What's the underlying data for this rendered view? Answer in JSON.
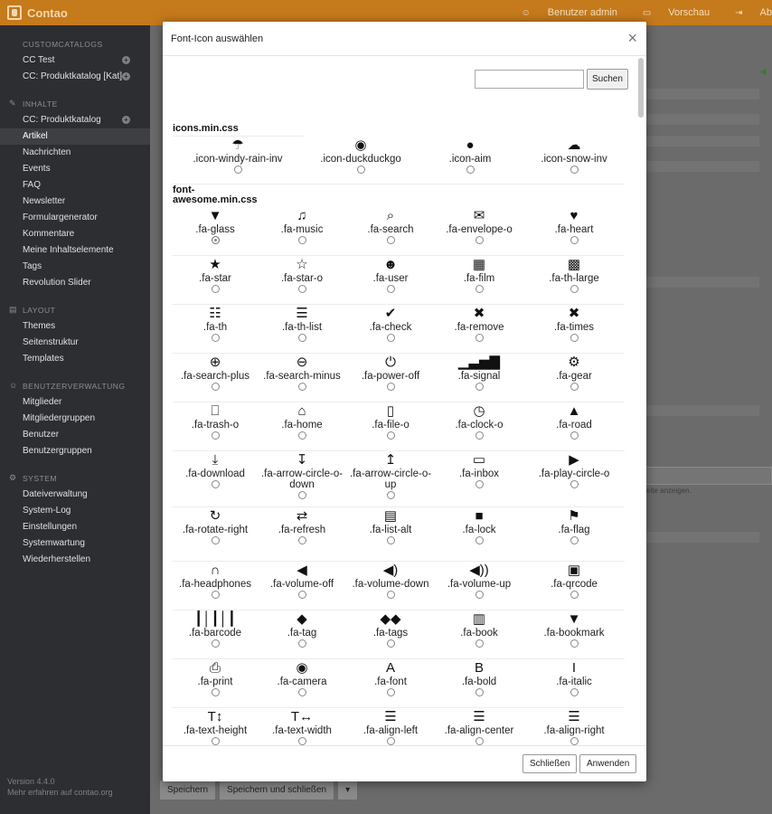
{
  "app": {
    "name": "Contao"
  },
  "header": {
    "nav": [
      {
        "icon": "user-icon",
        "glyph": "☺",
        "label": "Benutzer admin"
      },
      {
        "icon": "monitor-icon",
        "glyph": "▭",
        "label": "Vorschau"
      },
      {
        "icon": "logout-icon",
        "glyph": "⇥",
        "label": "Ab"
      }
    ]
  },
  "sidebar": {
    "groups": [
      {
        "title": "CUSTOMCATALOGS",
        "icon": "",
        "items": [
          {
            "label": "CC Test",
            "plus": true
          },
          {
            "label": "CC: Produktkatalog [Kat]",
            "plus": true
          }
        ]
      },
      {
        "title": "INHALTE",
        "icon": "✎",
        "items": [
          {
            "label": "CC: Produktkatalog",
            "plus": true
          },
          {
            "label": "Artikel",
            "active": true
          },
          {
            "label": "Nachrichten"
          },
          {
            "label": "Events"
          },
          {
            "label": "FAQ"
          },
          {
            "label": "Newsletter"
          },
          {
            "label": "Formulargenerator"
          },
          {
            "label": "Kommentare"
          },
          {
            "label": "Meine Inhaltselemente"
          },
          {
            "label": "Tags"
          },
          {
            "label": "Revolution Slider"
          }
        ]
      },
      {
        "title": "LAYOUT",
        "icon": "▤",
        "items": [
          {
            "label": "Themes"
          },
          {
            "label": "Seitenstruktur"
          },
          {
            "label": "Templates"
          }
        ]
      },
      {
        "title": "BENUTZERVERWALTUNG",
        "icon": "☺",
        "items": [
          {
            "label": "Mitglieder"
          },
          {
            "label": "Mitgliedergruppen"
          },
          {
            "label": "Benutzer"
          },
          {
            "label": "Benutzergruppen"
          }
        ]
      },
      {
        "title": "SYSTEM",
        "icon": "⚙",
        "items": [
          {
            "label": "Dateiverwaltung"
          },
          {
            "label": "System-Log"
          },
          {
            "label": "Einstellungen"
          },
          {
            "label": "Systemwartung"
          },
          {
            "label": "Wiederherstellen"
          }
        ]
      }
    ],
    "footer": {
      "version": "Version 4.4.0",
      "more": "Mehr erfahren auf contao.org"
    }
  },
  "main": {
    "save_label": "Speichern",
    "save_close_label": "Speichern und schließen",
    "hint": "seite anzeigen."
  },
  "modal": {
    "title": "Font-Icon auswählen",
    "close_glyph": "×",
    "search": {
      "placeholder": "",
      "button": "Suchen"
    },
    "sections": [
      {
        "title": "icons.min.css",
        "icons": [
          {
            "name": ".icon-windy-rain-inv",
            "glyph": "☂",
            "icon": "windy-rain-icon"
          },
          {
            "name": ".icon-duckduckgo",
            "glyph": "◉",
            "icon": "duckduckgo-icon"
          },
          {
            "name": ".icon-aim",
            "glyph": "●",
            "icon": "aim-icon"
          },
          {
            "name": ".icon-snow-inv",
            "glyph": "☁",
            "icon": "snow-icon"
          }
        ]
      },
      {
        "title": "font-awesome.min.css",
        "icons": [
          {
            "name": ".fa-glass",
            "glyph": "▼",
            "icon": "glass-icon",
            "checked": true
          },
          {
            "name": ".fa-music",
            "glyph": "♫",
            "icon": "music-icon"
          },
          {
            "name": ".fa-search",
            "glyph": "⌕",
            "icon": "search-icon"
          },
          {
            "name": ".fa-envelope-o",
            "glyph": "✉",
            "icon": "envelope-icon"
          },
          {
            "name": ".fa-heart",
            "glyph": "♥",
            "icon": "heart-icon"
          },
          {
            "name": ".fa-star",
            "glyph": "★",
            "icon": "star-icon"
          },
          {
            "name": ".fa-star-o",
            "glyph": "☆",
            "icon": "star-outline-icon"
          },
          {
            "name": ".fa-user",
            "glyph": "☻",
            "icon": "user-icon"
          },
          {
            "name": ".fa-film",
            "glyph": "▦",
            "icon": "film-icon"
          },
          {
            "name": ".fa-th-large",
            "glyph": "▩",
            "icon": "th-large-icon"
          },
          {
            "name": ".fa-th",
            "glyph": "☷",
            "icon": "th-icon"
          },
          {
            "name": ".fa-th-list",
            "glyph": "☰",
            "icon": "th-list-icon"
          },
          {
            "name": ".fa-check",
            "glyph": "✔",
            "icon": "check-icon"
          },
          {
            "name": ".fa-remove",
            "glyph": "✖",
            "icon": "remove-icon"
          },
          {
            "name": ".fa-times",
            "glyph": "✖",
            "icon": "times-icon"
          },
          {
            "name": ".fa-search-plus",
            "glyph": "⊕",
            "icon": "search-plus-icon"
          },
          {
            "name": ".fa-search-minus",
            "glyph": "⊖",
            "icon": "search-minus-icon"
          },
          {
            "name": ".fa-power-off",
            "glyph": "⏻",
            "icon": "power-off-icon"
          },
          {
            "name": ".fa-signal",
            "glyph": "▁▃▅▇",
            "icon": "signal-icon"
          },
          {
            "name": ".fa-gear",
            "glyph": "⚙",
            "icon": "gear-icon"
          },
          {
            "name": ".fa-trash-o",
            "glyph": "⎕",
            "icon": "trash-icon"
          },
          {
            "name": ".fa-home",
            "glyph": "⌂",
            "icon": "home-icon"
          },
          {
            "name": ".fa-file-o",
            "glyph": "▯",
            "icon": "file-icon"
          },
          {
            "name": ".fa-clock-o",
            "glyph": "◷",
            "icon": "clock-icon"
          },
          {
            "name": ".fa-road",
            "glyph": "▲",
            "icon": "road-icon"
          },
          {
            "name": ".fa-download",
            "glyph": "⤓",
            "icon": "download-icon"
          },
          {
            "name": ".fa-arrow-circle-o-down",
            "glyph": "↧",
            "icon": "arrow-circle-down-icon"
          },
          {
            "name": ".fa-arrow-circle-o-up",
            "glyph": "↥",
            "icon": "arrow-circle-up-icon"
          },
          {
            "name": ".fa-inbox",
            "glyph": "▭",
            "icon": "inbox-icon"
          },
          {
            "name": ".fa-play-circle-o",
            "glyph": "▶",
            "icon": "play-circle-icon"
          },
          {
            "name": ".fa-rotate-right",
            "glyph": "↻",
            "icon": "rotate-right-icon"
          },
          {
            "name": ".fa-refresh",
            "glyph": "⇄",
            "icon": "refresh-icon"
          },
          {
            "name": ".fa-list-alt",
            "glyph": "▤",
            "icon": "list-alt-icon"
          },
          {
            "name": ".fa-lock",
            "glyph": "■",
            "icon": "lock-icon"
          },
          {
            "name": ".fa-flag",
            "glyph": "⚑",
            "icon": "flag-icon"
          },
          {
            "name": ".fa-headphones",
            "glyph": "∩",
            "icon": "headphones-icon"
          },
          {
            "name": ".fa-volume-off",
            "glyph": "◀",
            "icon": "volume-off-icon"
          },
          {
            "name": ".fa-volume-down",
            "glyph": "◀)",
            "icon": "volume-down-icon"
          },
          {
            "name": ".fa-volume-up",
            "glyph": "◀))",
            "icon": "volume-up-icon"
          },
          {
            "name": ".fa-qrcode",
            "glyph": "▣",
            "icon": "qrcode-icon"
          },
          {
            "name": ".fa-barcode",
            "glyph": "┃│┃│┃",
            "icon": "barcode-icon"
          },
          {
            "name": ".fa-tag",
            "glyph": "◆",
            "icon": "tag-icon"
          },
          {
            "name": ".fa-tags",
            "glyph": "◆◆",
            "icon": "tags-icon"
          },
          {
            "name": ".fa-book",
            "glyph": "▥",
            "icon": "book-icon"
          },
          {
            "name": ".fa-bookmark",
            "glyph": "▼",
            "icon": "bookmark-icon"
          },
          {
            "name": ".fa-print",
            "glyph": "⎙",
            "icon": "print-icon"
          },
          {
            "name": ".fa-camera",
            "glyph": "◉",
            "icon": "camera-icon"
          },
          {
            "name": ".fa-font",
            "glyph": "A",
            "icon": "font-icon"
          },
          {
            "name": ".fa-bold",
            "glyph": "B",
            "icon": "bold-icon"
          },
          {
            "name": ".fa-italic",
            "glyph": "I",
            "icon": "italic-icon"
          },
          {
            "name": ".fa-text-height",
            "glyph": "T↕",
            "icon": "text-height-icon"
          },
          {
            "name": ".fa-text-width",
            "glyph": "T↔",
            "icon": "text-width-icon"
          },
          {
            "name": ".fa-align-left",
            "glyph": "☰",
            "icon": "align-left-icon"
          },
          {
            "name": ".fa-align-center",
            "glyph": "☰",
            "icon": "align-center-icon"
          },
          {
            "name": ".fa-align-right",
            "glyph": "☰",
            "icon": "align-right-icon"
          },
          {
            "name": "",
            "glyph": "☰",
            "icon": "align-justify-icon"
          },
          {
            "name": "",
            "glyph": "☰",
            "icon": "list-icon"
          },
          {
            "name": "",
            "glyph": "⇤",
            "icon": "outdent-icon"
          },
          {
            "name": "",
            "glyph": "⇥",
            "icon": "indent-icon"
          },
          {
            "name": "",
            "glyph": "■",
            "icon": "video-camera-icon"
          }
        ]
      }
    ],
    "footer": {
      "close": "Schließen",
      "apply": "Anwenden"
    }
  }
}
